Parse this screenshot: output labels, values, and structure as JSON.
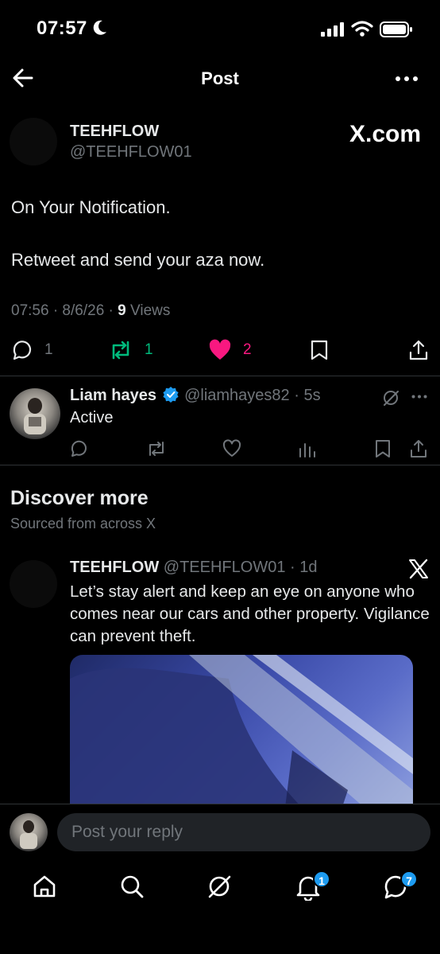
{
  "status_bar": {
    "time": "07:57"
  },
  "header": {
    "title": "Post"
  },
  "post": {
    "author_name": "TEEHFLOW",
    "author_handle": "@TEEHFLOW01",
    "brand_label": "X.com",
    "line1": "On Your Notification.",
    "line2": "Retweet and send your aza now.",
    "meta_prefix": "07:56 · 8/6/26 · ",
    "views_count": "9",
    "views_label": "Views",
    "replies": "1",
    "reposts": "1",
    "likes": "2"
  },
  "reply": {
    "name": "Liam hayes",
    "handle_time": "@liamhayes82 · 5s",
    "text": "Active"
  },
  "discover": {
    "title": "Discover more",
    "subtitle": "Sourced from across X",
    "tweet": {
      "name": "TEEHFLOW",
      "handle_time": "@TEEHFLOW01 · 1d",
      "text": "Let’s stay alert and keep an eye on anyone who comes near our cars and other property. Vigilance can prevent theft."
    }
  },
  "composer": {
    "placeholder": "Post your reply"
  },
  "nav": {
    "notifications_badge": "1",
    "messages_badge": "7"
  },
  "colors": {
    "like": "#f91880",
    "repost": "#00ba7c",
    "accent": "#1d9bf0"
  }
}
